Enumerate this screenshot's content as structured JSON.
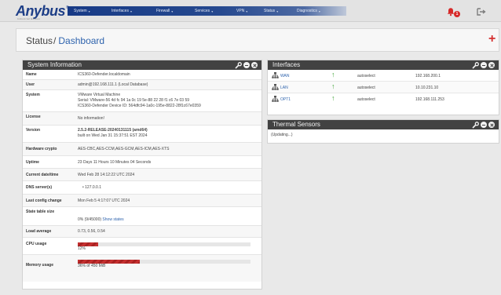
{
  "brand": {
    "logo_text": "Anybus",
    "logo_reg": "®",
    "logo_sub": "Industrial Edition"
  },
  "nav": {
    "items": [
      {
        "label": "System",
        "caret": "▾"
      },
      {
        "label": "Interfaces",
        "caret": "▾"
      },
      {
        "label": "Firewall",
        "caret": "▾"
      },
      {
        "label": "Services",
        "caret": "▾"
      },
      {
        "label": "VPN",
        "caret": "▾"
      },
      {
        "label": "Status",
        "caret": "▾"
      },
      {
        "label": "Diagnostics",
        "caret": "▾"
      }
    ],
    "notification_count": "1"
  },
  "breadcrumb": {
    "section": "Status",
    "separator": "/",
    "page": "Dashboard",
    "add_label": "+"
  },
  "system_info": {
    "title": "System Information",
    "rows": [
      {
        "label": "Name",
        "lines": [
          "ICS360-Defender.localdomain"
        ]
      },
      {
        "label": "User",
        "lines": [
          "admin@192.168.111.1 (Local Database)"
        ]
      },
      {
        "label": "System",
        "lines": [
          "VMware Virtual Machine",
          "Serial: VMware-56 4d fc 94 1a 0c 19 5e-88 22 28 f1 c6 7e 03 59",
          "ICS360-Defender Device ID: 564dfc94-1a0c-195e-8822-28f1c67e0359"
        ]
      },
      {
        "label": "License",
        "lines": [
          "No information!"
        ]
      },
      {
        "label": "Version",
        "lines": [
          "2.5.2-RELEASE-20240131115 (amd64)",
          "built on Wed Jan 31 15:37:51 EST 2024"
        ]
      },
      {
        "label": "Hardware crypto",
        "lines": [
          "AES-CBC,AES-CCM,AES-GCM,AES-ICM,AES-XTS"
        ]
      },
      {
        "label": "Uptime",
        "lines": [
          "23 Days 11 Hours 10 Minutes 04 Seconds"
        ]
      },
      {
        "label": "Current date/time",
        "lines": [
          "Wed Feb 28 14:12:22 UTC 2024"
        ]
      },
      {
        "label": "DNS server(s)",
        "lines": [
          "• 127.0.0.1"
        ]
      },
      {
        "label": "Last config change",
        "lines": [
          "Mon Feb 5 4:17:07 UTC 2024"
        ]
      }
    ],
    "state_table": {
      "label": "State table size",
      "value": "0% (9/45000)",
      "link": "Show states"
    },
    "load_average": {
      "label": "Load average",
      "value": "0.73, 0.56, 0.54"
    },
    "cpu": {
      "label": "CPU usage",
      "percent": 12,
      "text": "12%"
    },
    "memory": {
      "label": "Memory usage",
      "percent": 36,
      "text": "36% of 450 MiB"
    }
  },
  "interfaces": {
    "title": "Interfaces",
    "rows": [
      {
        "name": "WAN",
        "status": "↑",
        "media": "autoselect",
        "ip": "192.168.200.1"
      },
      {
        "name": "LAN",
        "status": "↑",
        "media": "autoselect",
        "ip": "10.10.231.10"
      },
      {
        "name": "OPT1",
        "status": "↑",
        "media": "autoselect",
        "ip": "192.168.111.253"
      }
    ]
  },
  "thermal": {
    "title": "Thermal Sensors",
    "status": "(Updating...)"
  },
  "colors": {
    "brand_blue": "#1d3e87",
    "link_blue": "#2e63ad",
    "panel_header": "#424242",
    "usage_red": "#c53030",
    "status_green": "#3fa336",
    "alert_red": "#d62828"
  }
}
